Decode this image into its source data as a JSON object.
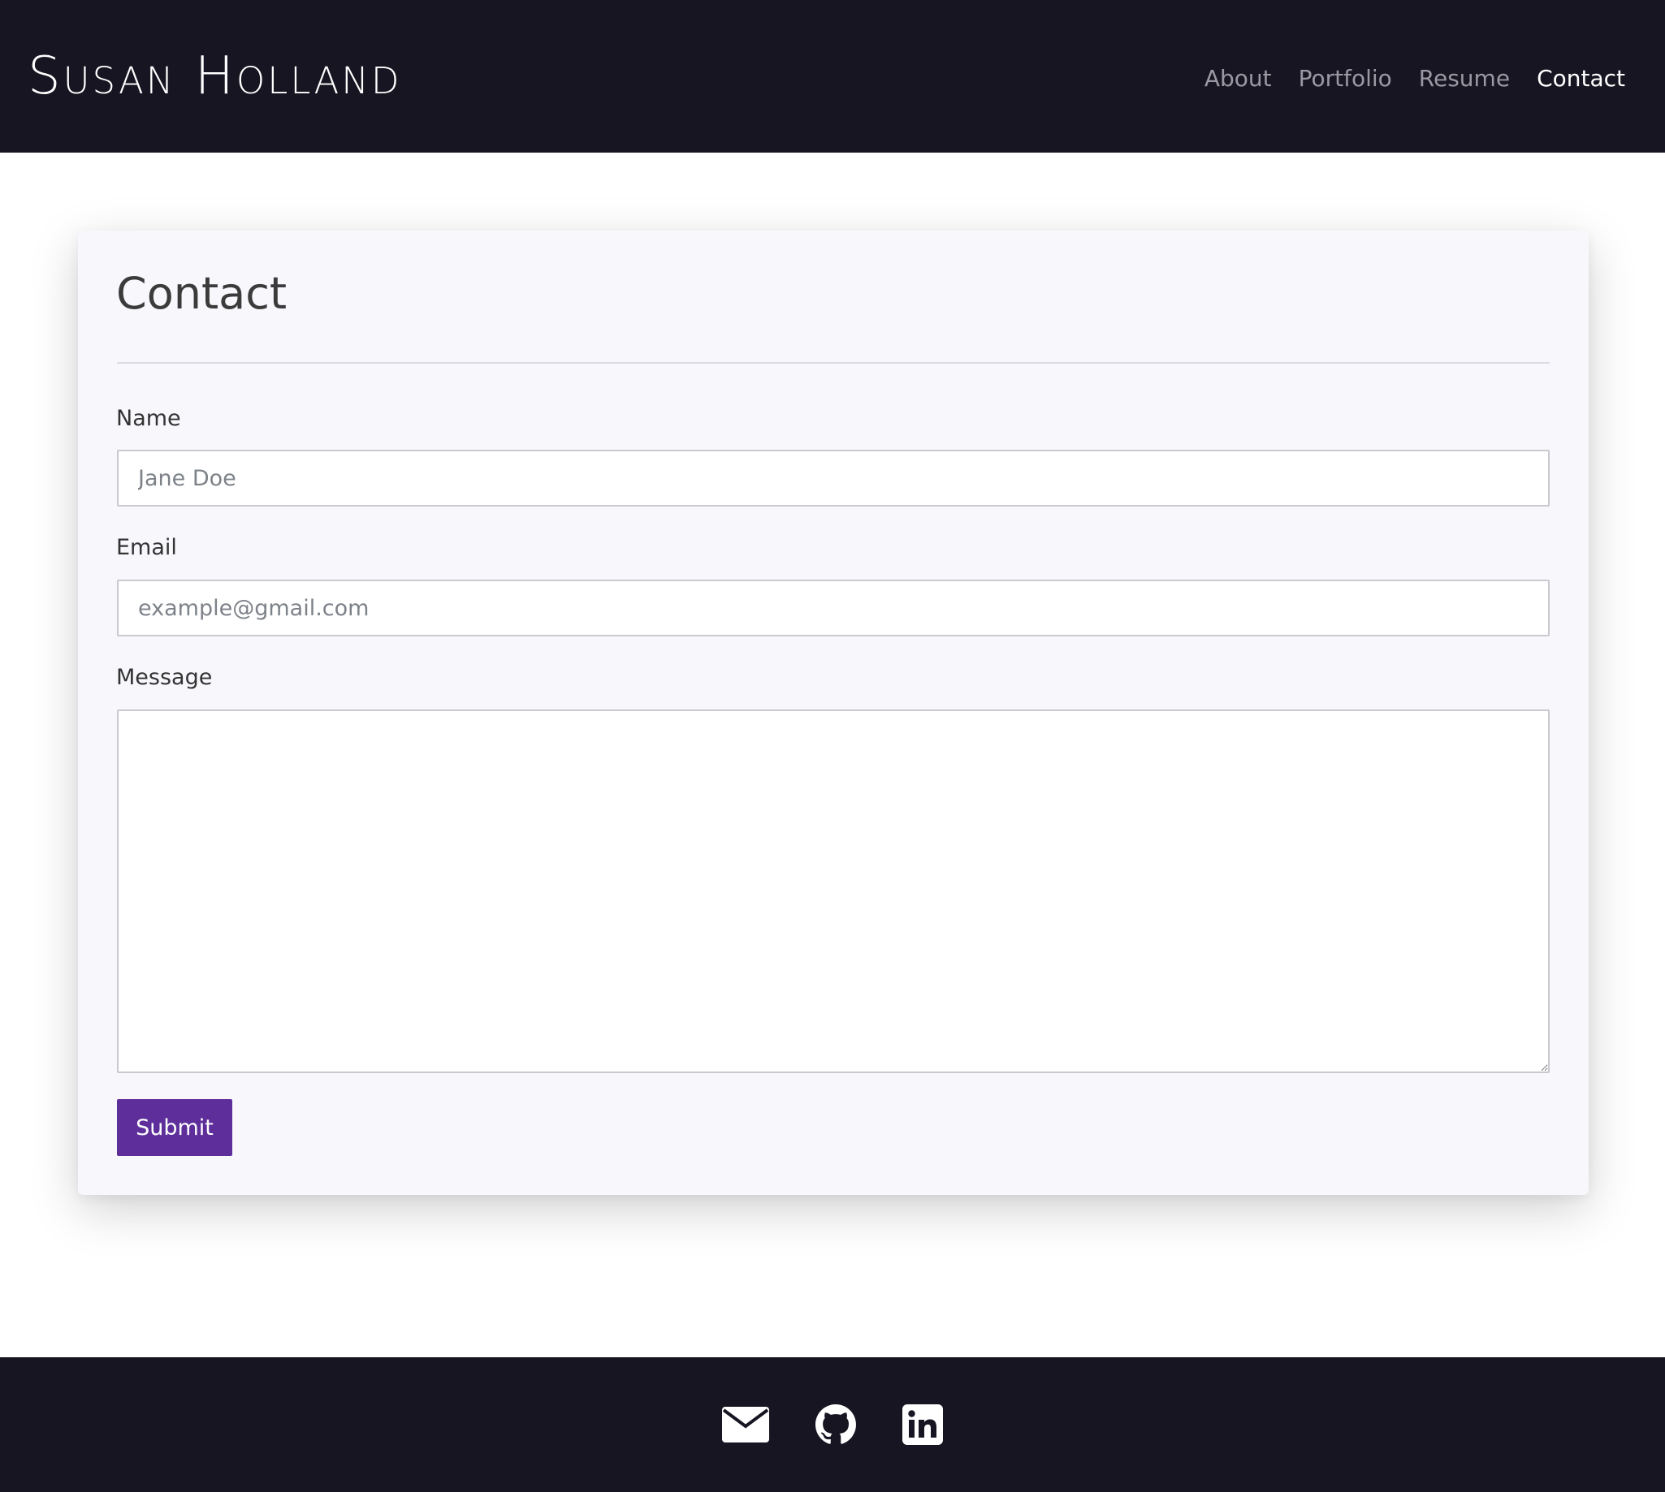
{
  "header": {
    "brand": "Susan Holland",
    "nav": [
      {
        "label": "About",
        "active": false
      },
      {
        "label": "Portfolio",
        "active": false
      },
      {
        "label": "Resume",
        "active": false
      },
      {
        "label": "Contact",
        "active": true
      }
    ]
  },
  "contact_card": {
    "title": "Contact",
    "name": {
      "label": "Name",
      "placeholder": "Jane Doe",
      "value": ""
    },
    "email": {
      "label": "Email",
      "placeholder": "example@gmail.com",
      "value": ""
    },
    "message": {
      "label": "Message",
      "placeholder": "",
      "value": ""
    },
    "submit_label": "Submit"
  },
  "footer": {
    "icons": [
      "envelope-icon",
      "github-icon",
      "linkedin-icon"
    ]
  },
  "colors": {
    "header_bg": "#181522",
    "footer_bg": "#181522",
    "card_bg": "#f8f7fc",
    "accent": "#5e2f9a",
    "nav_inactive": "#9a98a3",
    "nav_active": "#ffffff"
  }
}
